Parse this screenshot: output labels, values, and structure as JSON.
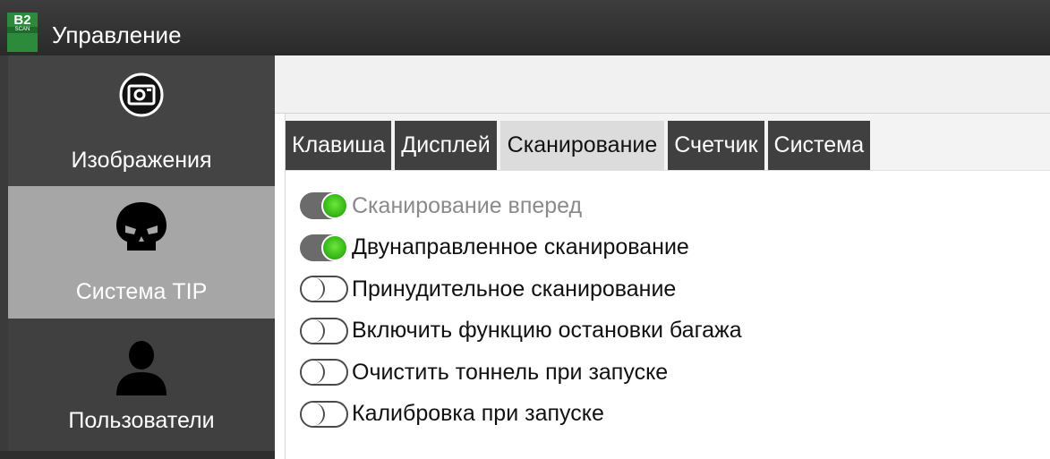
{
  "window": {
    "logo_text": "B2",
    "logo_sub": "SCAN",
    "title": "Управление"
  },
  "sidebar": {
    "items": [
      {
        "label": "Изображения",
        "icon": "camera-icon",
        "active": false
      },
      {
        "label": "Система TIP",
        "icon": "skull-icon",
        "active": true
      },
      {
        "label": "Пользователи",
        "icon": "user-icon",
        "active": false
      }
    ]
  },
  "tabs": [
    {
      "label": "Клавиша",
      "active": false
    },
    {
      "label": "Дисплей",
      "active": false
    },
    {
      "label": "Сканирование",
      "active": true
    },
    {
      "label": "Счетчик",
      "active": false
    },
    {
      "label": "Система",
      "active": false
    }
  ],
  "options": [
    {
      "label": "Сканирование вперед",
      "on": true,
      "disabled": true
    },
    {
      "label": "Двунаправленное сканирование",
      "on": true,
      "disabled": false
    },
    {
      "label": "Принудительное сканирование",
      "on": false,
      "disabled": false
    },
    {
      "label": "Включить функцию остановки багажа",
      "on": false,
      "disabled": false
    },
    {
      "label": "Очистить тоннель при запуске",
      "on": false,
      "disabled": false
    },
    {
      "label": "Калибровка при запуске",
      "on": false,
      "disabled": false
    }
  ],
  "colors": {
    "toggle_on": "#3bbd1c",
    "sidebar_active": "#a6a6a6",
    "sidebar_bg": "#3b3b3b",
    "tab_active": "#dcdcdc",
    "tab_inactive": "#404040"
  }
}
